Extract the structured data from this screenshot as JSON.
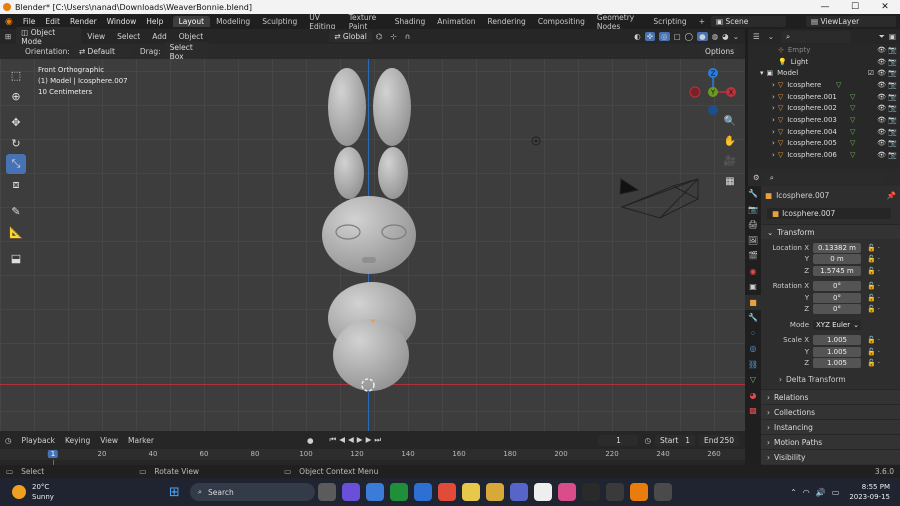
{
  "titlebar": {
    "title": "Blender* [C:\\Users\\nanad\\Downloads\\WeaverBonnie.blend]"
  },
  "menu": {
    "items": [
      "File",
      "Edit",
      "Render",
      "Window",
      "Help"
    ]
  },
  "workspaces": {
    "tabs": [
      "Layout",
      "Modeling",
      "Sculpting",
      "UV Editing",
      "Texture Paint",
      "Shading",
      "Animation",
      "Rendering",
      "Compositing",
      "Geometry Nodes",
      "Scripting"
    ],
    "add": "+",
    "active": "Layout"
  },
  "scene": {
    "label": "Scene",
    "view_layer": "ViewLayer"
  },
  "viewport_header": {
    "mode": "Object Mode",
    "view": "View",
    "select": "Select",
    "add": "Add",
    "object": "Object",
    "orientation": "Global"
  },
  "tool_settings": {
    "orientation_label": "Orientation:",
    "orientation_value": "Default",
    "drag_label": "Drag:",
    "drag_value": "Select Box",
    "options": "Options"
  },
  "viewport_info": {
    "view": "Front Orthographic",
    "object": "(1) Model | Icosphere.007",
    "scale": "10 Centimeters"
  },
  "gizmo": {
    "z": "Z",
    "y": "Y",
    "x": "X"
  },
  "outliner": {
    "search_placeholder": "",
    "rows": [
      {
        "name": "Empty",
        "indent": 1
      },
      {
        "name": "Light",
        "indent": 1
      },
      {
        "name": "Model",
        "indent": 0
      },
      {
        "name": "Icosphere",
        "indent": 1
      },
      {
        "name": "Icosphere.001",
        "indent": 1
      },
      {
        "name": "Icosphere.002",
        "indent": 1
      },
      {
        "name": "Icosphere.003",
        "indent": 1
      },
      {
        "name": "Icosphere.004",
        "indent": 1
      },
      {
        "name": "Icosphere.005",
        "indent": 1
      },
      {
        "name": "Icosphere.006",
        "indent": 1
      }
    ]
  },
  "properties": {
    "object_name": "Icosphere.007",
    "datablock": "Icosphere.007",
    "transform_label": "Transform",
    "location_label": "Location X",
    "location": [
      "0.13382 m",
      "0 m",
      "1.5745 m"
    ],
    "rotation_label": "Rotation X",
    "rotation": [
      "0°",
      "0°",
      "0°"
    ],
    "mode_label": "Mode",
    "mode_value": "XYZ Euler",
    "scale_label": "Scale X",
    "scale": [
      "1.005",
      "1.005",
      "1.005"
    ],
    "axis_y": "Y",
    "axis_z": "Z",
    "delta": "Delta Transform",
    "panels": [
      "Relations",
      "Collections",
      "Instancing",
      "Motion Paths",
      "Visibility"
    ]
  },
  "timeline": {
    "playback": "Playback",
    "keying": "Keying",
    "view": "View",
    "marker": "Marker",
    "current_frame": "1",
    "start_label": "Start",
    "start": "1",
    "end_label": "End",
    "end": "250",
    "ruler": [
      "1",
      "20",
      "40",
      "60",
      "80",
      "100",
      "120",
      "140",
      "160",
      "180",
      "200",
      "220",
      "240",
      "260"
    ]
  },
  "statusbar": {
    "select": "Select",
    "rotate": "Rotate View",
    "context": "Object Context Menu",
    "version": "3.6.0"
  },
  "taskbar": {
    "temp": "20°C",
    "weather": "Sunny",
    "search": "Search",
    "time": "8:55 PM",
    "date": "2023-09-15"
  },
  "colors": {
    "accent": "#4772b3",
    "orange": "#e87d0d",
    "x_axis": "#c0313b",
    "y_axis": "#6a9a23",
    "z_axis": "#2b7ddb",
    "mesh": "#b0b0b0"
  }
}
